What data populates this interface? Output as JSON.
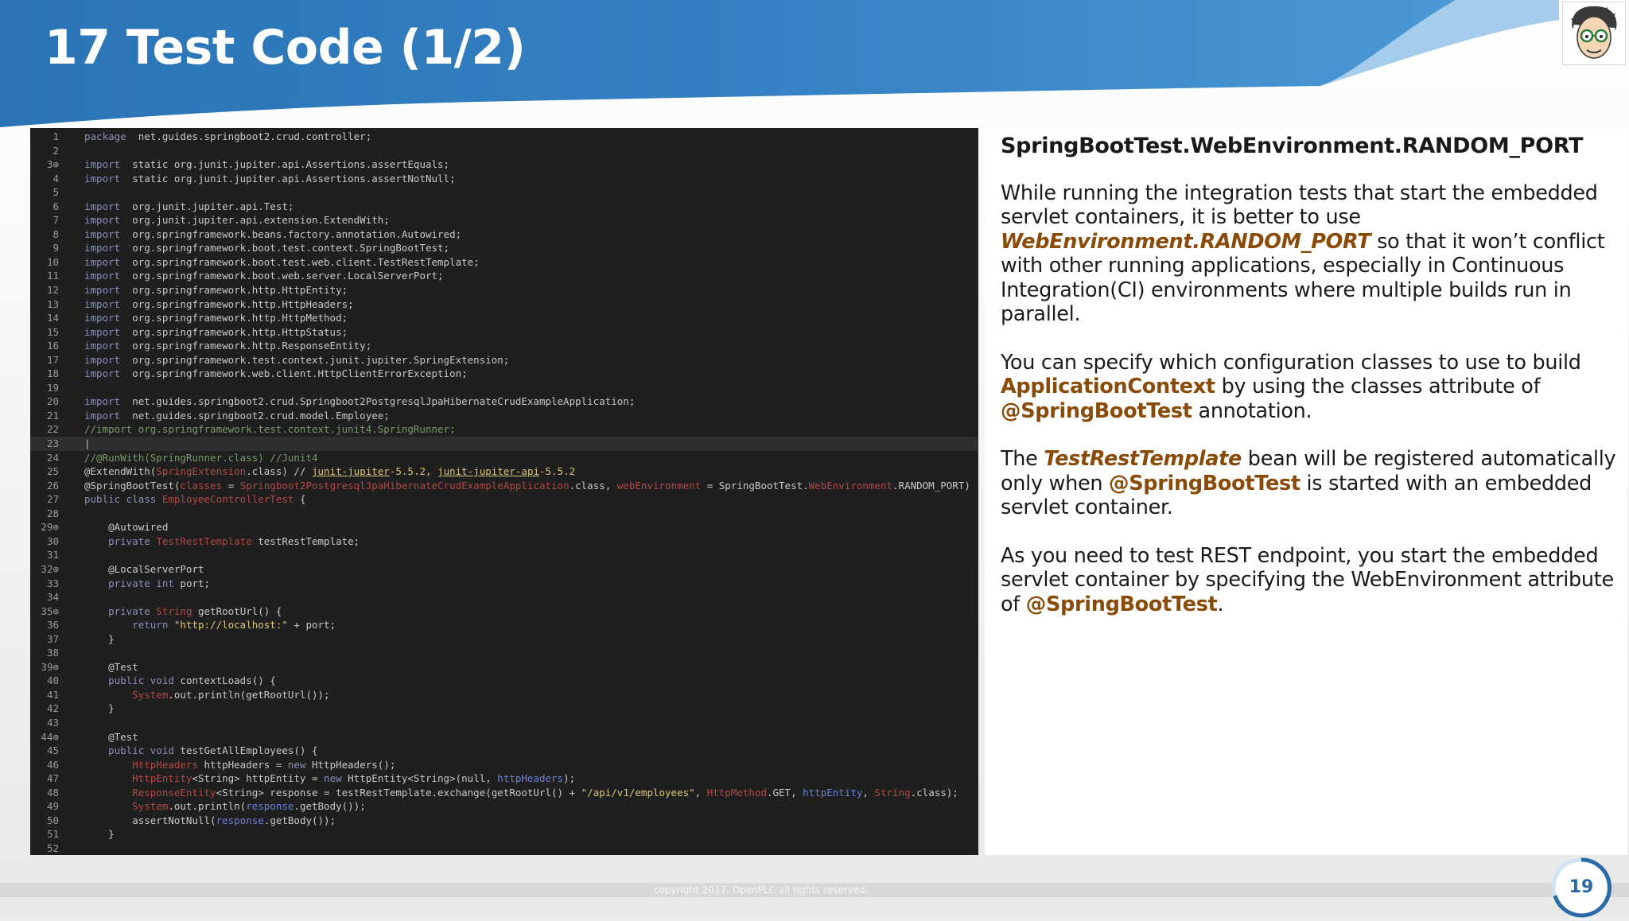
{
  "slide": {
    "title": "17 Test Code (1/2)",
    "page_number": "19",
    "copyright": "copyright 2017. OpenPLC all rights reserved."
  },
  "colors": {
    "header_blue": "#2f7fc0",
    "highlight": "#8a4b08",
    "code_background": "#1f1f1f"
  },
  "code": {
    "lines": [
      {
        "n": "1",
        "segs": [
          [
            "k",
            "package"
          ],
          [
            "",
            "  net.guides.springboot2.crud.controller;"
          ]
        ]
      },
      {
        "n": "2",
        "segs": []
      },
      {
        "n": "3⊕",
        "segs": [
          [
            "k",
            "import"
          ],
          [
            "",
            "  static org.junit.jupiter.api.Assertions.assertEquals;"
          ]
        ]
      },
      {
        "n": "4",
        "segs": [
          [
            "k",
            "import"
          ],
          [
            "",
            "  static org.junit.jupiter.api.Assertions.assertNotNull;"
          ]
        ]
      },
      {
        "n": "5",
        "segs": []
      },
      {
        "n": "6",
        "segs": [
          [
            "k",
            "import"
          ],
          [
            "",
            "  org.junit.jupiter.api.Test;"
          ]
        ]
      },
      {
        "n": "7",
        "segs": [
          [
            "k",
            "import"
          ],
          [
            "",
            "  org.junit.jupiter.api.extension.ExtendWith;"
          ]
        ]
      },
      {
        "n": "8",
        "segs": [
          [
            "k",
            "import"
          ],
          [
            "",
            "  org.springframework.beans.factory.annotation.Autowired;"
          ]
        ]
      },
      {
        "n": "9",
        "segs": [
          [
            "k",
            "import"
          ],
          [
            "",
            "  org.springframework.boot.test.context.SpringBootTest;"
          ]
        ]
      },
      {
        "n": "10",
        "segs": [
          [
            "k",
            "import"
          ],
          [
            "",
            "  org.springframework.boot.test.web.client.TestRestTemplate;"
          ]
        ]
      },
      {
        "n": "11",
        "segs": [
          [
            "k",
            "import"
          ],
          [
            "",
            "  org.springframework.boot.web.server.LocalServerPort;"
          ]
        ]
      },
      {
        "n": "12",
        "segs": [
          [
            "k",
            "import"
          ],
          [
            "",
            "  org.springframework.http.HttpEntity;"
          ]
        ]
      },
      {
        "n": "13",
        "segs": [
          [
            "k",
            "import"
          ],
          [
            "",
            "  org.springframework.http.HttpHeaders;"
          ]
        ]
      },
      {
        "n": "14",
        "segs": [
          [
            "k",
            "import"
          ],
          [
            "",
            "  org.springframework.http.HttpMethod;"
          ]
        ]
      },
      {
        "n": "15",
        "segs": [
          [
            "k",
            "import"
          ],
          [
            "",
            "  org.springframework.http.HttpStatus;"
          ]
        ]
      },
      {
        "n": "16",
        "segs": [
          [
            "k",
            "import"
          ],
          [
            "",
            "  org.springframework.http.ResponseEntity;"
          ]
        ]
      },
      {
        "n": "17",
        "segs": [
          [
            "k",
            "import"
          ],
          [
            "",
            "  org.springframework.test.context.junit.jupiter.SpringExtension;"
          ]
        ]
      },
      {
        "n": "18",
        "segs": [
          [
            "k",
            "import"
          ],
          [
            "",
            "  org.springframework.web.client.HttpClientErrorException;"
          ]
        ]
      },
      {
        "n": "19",
        "segs": []
      },
      {
        "n": "20",
        "segs": [
          [
            "k",
            "import"
          ],
          [
            "",
            "  net.guides.springboot2.crud.Springboot2PostgresqlJpaHibernateCrudExampleApplication;"
          ]
        ]
      },
      {
        "n": "21",
        "segs": [
          [
            "k",
            "import"
          ],
          [
            "",
            "  net.guides.springboot2.crud.model.Employee;"
          ]
        ]
      },
      {
        "n": "22",
        "segs": [
          [
            "c",
            "//import org.springframework.test.context.junit4.SpringRunner;"
          ]
        ]
      },
      {
        "n": "23",
        "segs": [
          [
            "",
            "|"
          ]
        ],
        "cur": true
      },
      {
        "n": "24",
        "segs": [
          [
            "c",
            "//@RunWith(SpringRunner.class) //Junit4"
          ]
        ]
      },
      {
        "n": "25",
        "segs": [
          [
            "",
            "@ExtendWith("
          ],
          [
            "r",
            "SpringExtension"
          ],
          [
            "",
            ".class) // "
          ],
          [
            "u",
            "junit-jupiter"
          ],
          [
            "s",
            "-5.5.2, "
          ],
          [
            "u",
            "junit-jupiter-api"
          ],
          [
            "s",
            "-5.5.2"
          ]
        ]
      },
      {
        "n": "26",
        "segs": [
          [
            "",
            "@SpringBootTest("
          ],
          [
            "r",
            "classes"
          ],
          [
            "",
            " = "
          ],
          [
            "r",
            "Springboot2PostgresqlJpaHibernateCrudExampleApplication"
          ],
          [
            "",
            ".class, "
          ],
          [
            "r",
            "webEnvironment"
          ],
          [
            "",
            " = SpringBootTest."
          ],
          [
            "r",
            "WebEnvironment"
          ],
          [
            "",
            ".RANDOM_PORT)"
          ]
        ]
      },
      {
        "n": "27",
        "segs": [
          [
            "k",
            "public class"
          ],
          [
            "",
            " "
          ],
          [
            "r",
            "EmployeeControllerTest"
          ],
          [
            "",
            " {"
          ]
        ]
      },
      {
        "n": "28",
        "segs": []
      },
      {
        "n": "29⊕",
        "segs": [
          [
            "",
            "    @Autowired"
          ]
        ]
      },
      {
        "n": "30",
        "segs": [
          [
            "k",
            "    private"
          ],
          [
            "",
            " "
          ],
          [
            "r",
            "TestRestTemplate"
          ],
          [
            "",
            " testRestTemplate;"
          ]
        ]
      },
      {
        "n": "31",
        "segs": []
      },
      {
        "n": "32⊕",
        "segs": [
          [
            "",
            "    @LocalServerPort"
          ]
        ]
      },
      {
        "n": "33",
        "segs": [
          [
            "k",
            "    private int"
          ],
          [
            "",
            " port;"
          ]
        ]
      },
      {
        "n": "34",
        "segs": []
      },
      {
        "n": "35⊕",
        "segs": [
          [
            "k",
            "    private"
          ],
          [
            "",
            " "
          ],
          [
            "r",
            "String"
          ],
          [
            "",
            " getRootUrl() {"
          ]
        ]
      },
      {
        "n": "36",
        "segs": [
          [
            "k",
            "        return"
          ],
          [
            "",
            " "
          ],
          [
            "s",
            "\"http://localhost:\""
          ],
          [
            "",
            " + port;"
          ]
        ]
      },
      {
        "n": "37",
        "segs": [
          [
            "",
            "    }"
          ]
        ]
      },
      {
        "n": "38",
        "segs": []
      },
      {
        "n": "39⊕",
        "segs": [
          [
            "",
            "    @Test"
          ]
        ]
      },
      {
        "n": "40",
        "segs": [
          [
            "k",
            "    public void"
          ],
          [
            "",
            " contextLoads() {"
          ]
        ]
      },
      {
        "n": "41",
        "segs": [
          [
            "r",
            "        System"
          ],
          [
            "",
            ".out.println(getRootUrl());"
          ]
        ]
      },
      {
        "n": "42",
        "segs": [
          [
            "",
            "    }"
          ]
        ]
      },
      {
        "n": "43",
        "segs": []
      },
      {
        "n": "44⊕",
        "segs": [
          [
            "",
            "    @Test"
          ]
        ]
      },
      {
        "n": "45",
        "segs": [
          [
            "k",
            "    public void"
          ],
          [
            "",
            " testGetAllEmployees() {"
          ]
        ]
      },
      {
        "n": "46",
        "segs": [
          [
            "r",
            "        HttpHeaders"
          ],
          [
            "",
            " httpHeaders = "
          ],
          [
            "k",
            "new"
          ],
          [
            "",
            " HttpHeaders();"
          ]
        ]
      },
      {
        "n": "47",
        "segs": [
          [
            "r",
            "        HttpEntity"
          ],
          [
            "",
            "<String> httpEntity = "
          ],
          [
            "k",
            "new"
          ],
          [
            "",
            " HttpEntity<String>(null, "
          ],
          [
            "b",
            "httpHeaders"
          ],
          [
            "",
            ");"
          ]
        ]
      },
      {
        "n": "48",
        "segs": [
          [
            "r",
            "        ResponseEntity"
          ],
          [
            "",
            "<String> response = testRestTemplate.exchange(getRootUrl() + "
          ],
          [
            "s",
            "\"/api/v1/employees\""
          ],
          [
            "",
            ", "
          ],
          [
            "r",
            "HttpMethod"
          ],
          [
            "",
            ".GET, "
          ],
          [
            "b",
            "httpEntity"
          ],
          [
            "",
            ", "
          ],
          [
            "r",
            "String"
          ],
          [
            "",
            ".class);"
          ]
        ]
      },
      {
        "n": "49",
        "segs": [
          [
            "r",
            "        System"
          ],
          [
            "",
            ".out.println("
          ],
          [
            "b",
            "response"
          ],
          [
            "",
            ".getBody());"
          ]
        ]
      },
      {
        "n": "50",
        "segs": [
          [
            "",
            "        assertNotNull("
          ],
          [
            "b",
            "response"
          ],
          [
            "",
            ".getBody());"
          ]
        ]
      },
      {
        "n": "51",
        "segs": [
          [
            "",
            "    }"
          ]
        ]
      },
      {
        "n": "52",
        "segs": []
      }
    ]
  },
  "description": {
    "paragraphs": [
      {
        "cls": "heading",
        "segs": [
          [
            "",
            "SpringBootTest.WebEnvironment.RANDOM_PORT"
          ]
        ]
      },
      {
        "segs": [
          [
            "",
            "While running the integration tests that start the embedded servlet containers, it is better to use "
          ],
          [
            "hi",
            "WebEnvironment.RANDOM_PORT"
          ],
          [
            "",
            " so that it won’t conflict with other running applications, especially in Continuous Integration(CI) environments where multiple builds run in parallel."
          ]
        ]
      },
      {
        "segs": [
          [
            "",
            "You can specify which configuration classes to use to build "
          ],
          [
            "h",
            "ApplicationContext"
          ],
          [
            "",
            " by using the classes attribute of "
          ],
          [
            "h",
            "@SpringBootTest"
          ],
          [
            "",
            " annotation."
          ]
        ]
      },
      {
        "segs": [
          [
            "",
            "The "
          ],
          [
            "hi",
            "TestRestTemplate"
          ],
          [
            "",
            " bean will be registered automatically only when "
          ],
          [
            "h",
            "@SpringBootTest"
          ],
          [
            "",
            " is started with an embedded servlet container."
          ]
        ]
      },
      {
        "segs": [
          [
            "",
            "As you need to test REST endpoint, you start the embedded servlet container by specifying the WebEnvironment attribute of "
          ],
          [
            "h",
            "@SpringBootTest"
          ],
          [
            "",
            "."
          ]
        ]
      }
    ]
  }
}
